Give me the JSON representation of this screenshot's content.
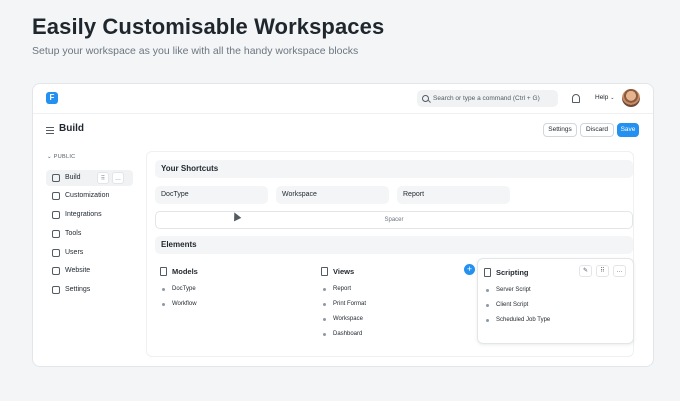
{
  "hero": {
    "title": "Easily Customisable Workspaces",
    "subtitle": "Setup your workspace as you like with all the handy workspace blocks"
  },
  "navbar": {
    "logo_letter": "F",
    "search_placeholder": "Search or type a command (Ctrl + G)",
    "help_label": "Help"
  },
  "page": {
    "title": "Build",
    "settings_label": "Settings",
    "discard_label": "Discard",
    "save_label": "Save"
  },
  "sidebar": {
    "section_label": "PUBLIC",
    "items": [
      {
        "label": "Build",
        "icon": "tool-icon"
      },
      {
        "label": "Customization",
        "icon": "customization-icon"
      },
      {
        "label": "Integrations",
        "icon": "integrations-icon"
      },
      {
        "label": "Tools",
        "icon": "tools-icon"
      },
      {
        "label": "Users",
        "icon": "users-icon"
      },
      {
        "label": "Website",
        "icon": "website-icon"
      },
      {
        "label": "Settings",
        "icon": "settings-icon"
      }
    ],
    "drag_glyph": "⠿",
    "more_glyph": "…"
  },
  "content": {
    "shortcuts_header": "Your Shortcuts",
    "shortcuts": [
      "DocType",
      "Workspace",
      "Report"
    ],
    "spacer_label": "Spacer",
    "elements_header": "Elements",
    "cards": [
      {
        "title": "Models",
        "links": [
          "DocType",
          "Workflow"
        ]
      },
      {
        "title": "Views",
        "links": [
          "Report",
          "Print Format",
          "Workspace",
          "Dashboard"
        ]
      },
      {
        "title": "Scripting",
        "links": [
          "Server Script",
          "Client Script",
          "Scheduled Job Type"
        ]
      }
    ],
    "add_glyph": "+",
    "edit_glyph": "✎"
  },
  "colors": {
    "accent": "#2490ef",
    "background": "#f4f5f6"
  }
}
